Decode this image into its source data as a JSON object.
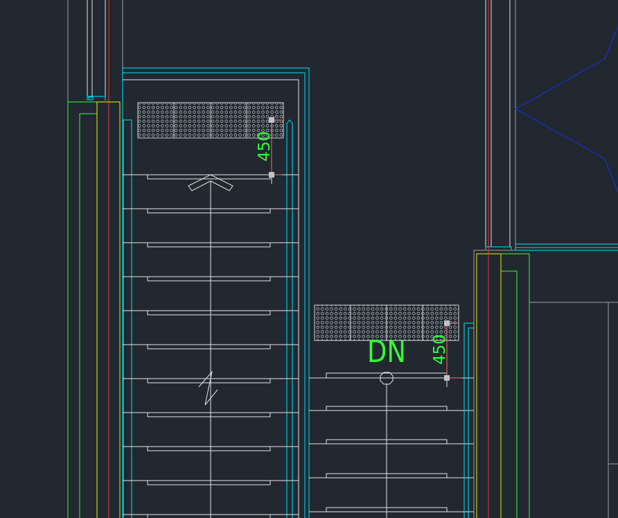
{
  "canvas": {
    "background": "#212830"
  },
  "colors": {
    "white": "#e6e6e6",
    "gray": "#9aa0a6",
    "cyan": "#00e5ff",
    "yellow": "#f2f200",
    "green": "#33ff33",
    "red": "#e53935",
    "blue": "#1a2fd0",
    "dim_red": "#ff6b6b",
    "label": "#33ff33"
  },
  "annotations": {
    "dimension_upper": "450",
    "dimension_lower": "450",
    "direction_label": "DN"
  },
  "symbols": {
    "tactile_paving": "tactile-paving-pattern",
    "direction_arrow": "up-arrow-chevron",
    "break_line": "break-line-symbol",
    "grip_points": "grip-square"
  }
}
